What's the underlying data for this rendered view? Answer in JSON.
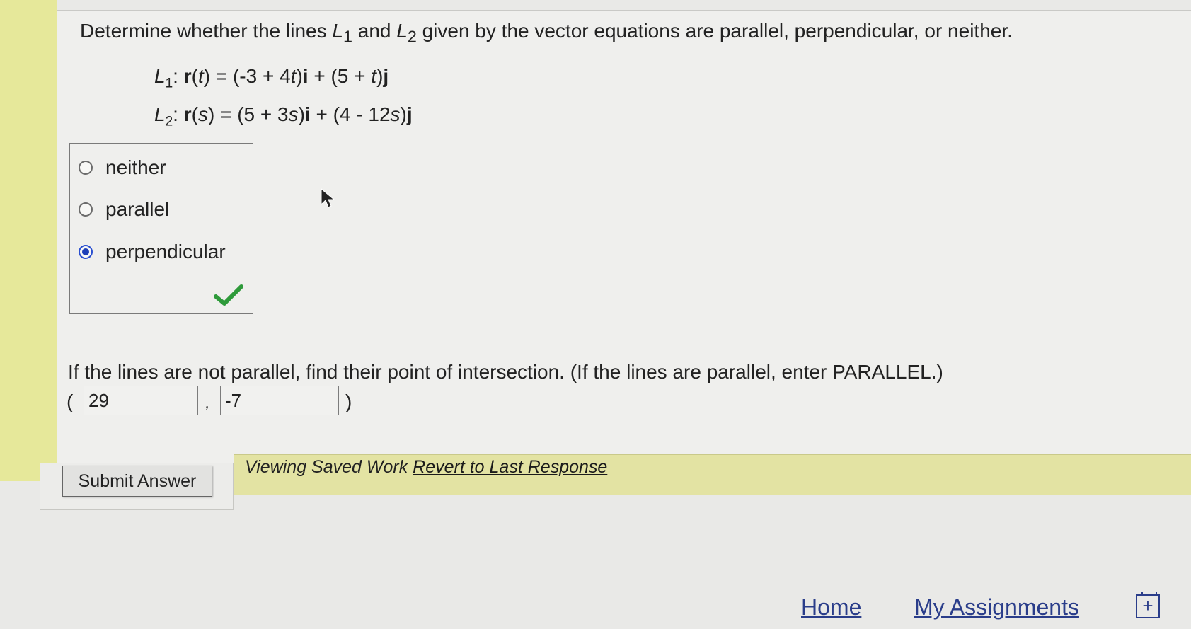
{
  "question": {
    "prompt_before_l1": "Determine whether the lines ",
    "prompt_l": "L",
    "prompt_l1_sub": "1",
    "prompt_and": " and ",
    "prompt_l2_sub": "2",
    "prompt_after": " given by the vector equations are parallel, perpendicular, or neither.",
    "eq1": {
      "label": "L",
      "label_sub": "1",
      "colon": ":",
      "r": "r",
      "lhs_var": "t",
      "mid1": ") = (-3 + 4",
      "mid2": ")",
      "i": "i",
      "mid3": " + (5 + ",
      "mid4": ")",
      "j": "j"
    },
    "eq2": {
      "label": "L",
      "label_sub": "2",
      "colon": ":",
      "r": "r",
      "lhs_var": "s",
      "mid1": ") = (5 + 3",
      "mid2": ")",
      "i": "i",
      "mid3": " + (4 - 12",
      "mid4": ")",
      "j": "j"
    }
  },
  "choices": [
    {
      "label": "neither",
      "selected": false
    },
    {
      "label": "parallel",
      "selected": false
    },
    {
      "label": "perpendicular",
      "selected": true
    }
  ],
  "intersection": {
    "prompt": "If the lines are not parallel, find their point of intersection. (If the lines are parallel, enter PARALLEL.)",
    "open_paren": "(",
    "comma": ",",
    "close_paren": ")",
    "x_value": "29",
    "y_value": "-7"
  },
  "actions": {
    "submit_label": "Submit Answer",
    "saved_text": "Viewing Saved Work ",
    "revert_label": "Revert to Last Response"
  },
  "footer": {
    "home": "Home",
    "assignments": "My Assignments"
  },
  "colors": {
    "highlight_yellow": "#e6e89a",
    "radio_selected": "#1d3fb8",
    "check_green": "#2e9a3a",
    "link_blue": "#2a3d8a"
  }
}
